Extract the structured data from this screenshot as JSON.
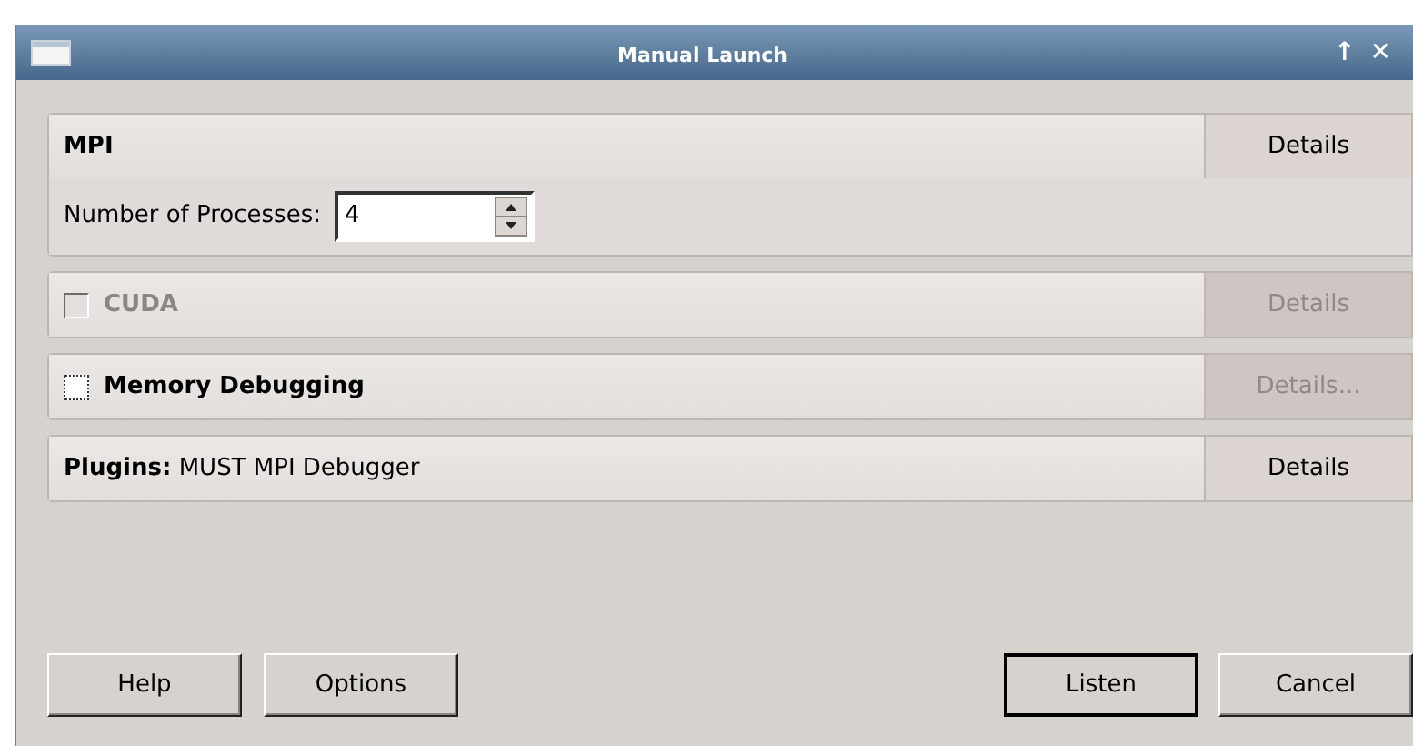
{
  "window": {
    "title": "Manual Launch",
    "controls": [
      "↑",
      "✕"
    ]
  },
  "sections": [
    {
      "kind": "mpi",
      "title": "MPI",
      "details": {
        "label": "Details",
        "disabled": false
      },
      "processes_label": "Number of Processes:",
      "processes_value": "4"
    },
    {
      "kind": "check",
      "title": "CUDA",
      "checked": false,
      "disabled": true,
      "details": {
        "label": "Details",
        "disabled": true
      }
    },
    {
      "kind": "check",
      "title": "Memory Debugging",
      "checked": false,
      "disabled": false,
      "details": {
        "label": "Details...",
        "disabled": true
      }
    },
    {
      "kind": "plugins",
      "title": "Plugins:",
      "value": "MUST MPI Debugger",
      "details": {
        "label": "Details",
        "disabled": false
      }
    }
  ],
  "buttons_left": [
    {
      "label": "Help",
      "default": false
    },
    {
      "label": "Options",
      "default": false
    }
  ],
  "buttons_right": [
    {
      "label": "Listen",
      "default": true
    },
    {
      "label": "Cancel",
      "default": false
    }
  ]
}
